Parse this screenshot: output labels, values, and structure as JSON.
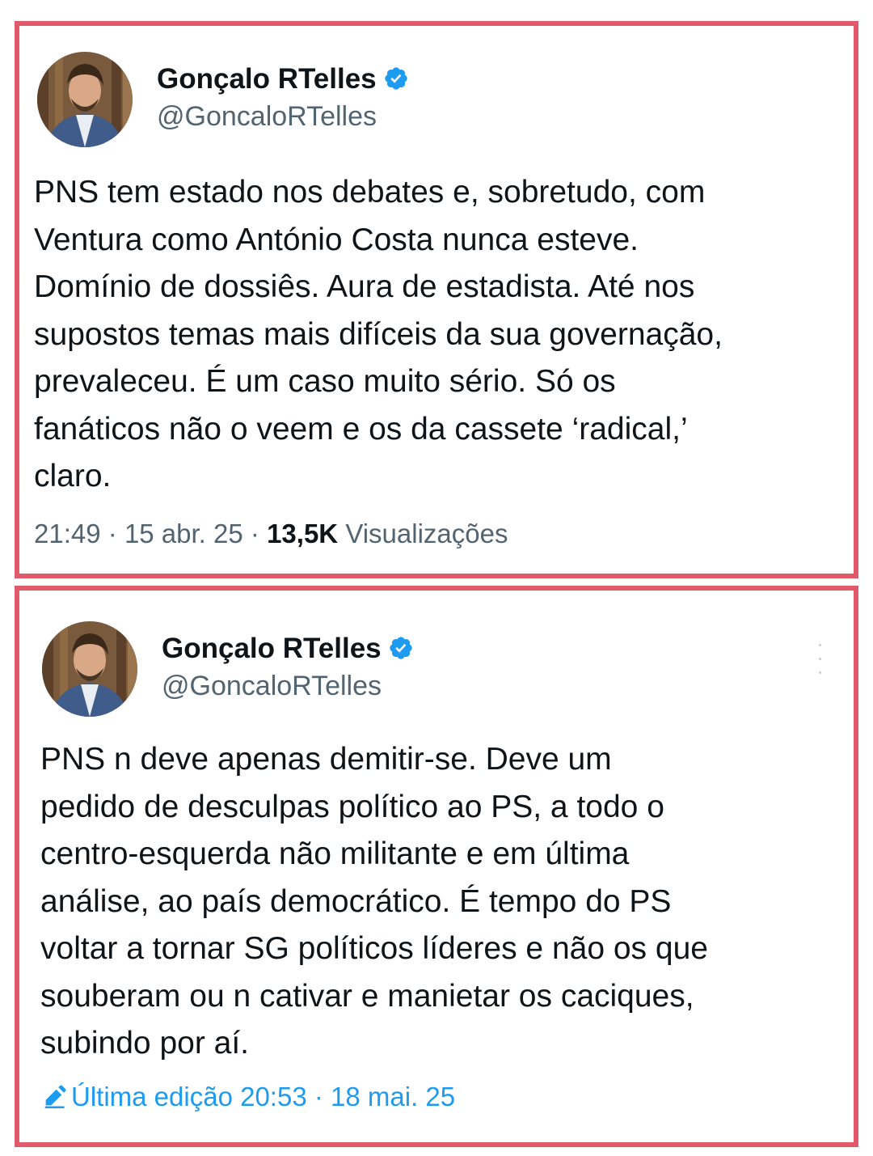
{
  "tweets": [
    {
      "author": {
        "display_name": "Gonçalo RTelles",
        "handle": "@GoncaloRTelles",
        "verified": true
      },
      "text_lines": [
        "PNS tem estado nos debates e, sobretudo, com",
        "Ventura como António Costa nunca esteve.",
        "Domínio de dossiês. Aura de estadista. Até nos",
        "supostos temas mais difíceis da sua governação,",
        "prevaleceu. É um caso muito sério. Só os",
        "fanáticos não o veem e os da cassete ‘radical,’",
        "claro."
      ],
      "time": "21:49",
      "separator": "·",
      "date": "15 abr. 25",
      "views_count": "13,5K",
      "views_label": "Visualizações"
    },
    {
      "author": {
        "display_name": "Gonçalo RTelles",
        "handle": "@GoncaloRTelles",
        "verified": true
      },
      "text_lines": [
        "PNS n deve apenas demitir-se. Deve um",
        "pedido de desculpas político ao PS, a todo o",
        "centro-esquerda não militante e em última",
        "análise, ao país democrático. É tempo do PS",
        "voltar a tornar SG políticos líderes e não os que",
        "souberam ou n cativar e manietar os caciques,",
        "subindo por aí."
      ],
      "edited_label": "Última edição",
      "time": "20:53",
      "separator": "·",
      "date": "18 mai. 25",
      "icons": {
        "edit": "pencil-icon",
        "more": "more-options-icon"
      }
    }
  ],
  "colors": {
    "frame_border": "#e05a6a",
    "verified_blue": "#1d9bf0",
    "secondary_text": "#536471",
    "primary_text": "#0f1419"
  }
}
